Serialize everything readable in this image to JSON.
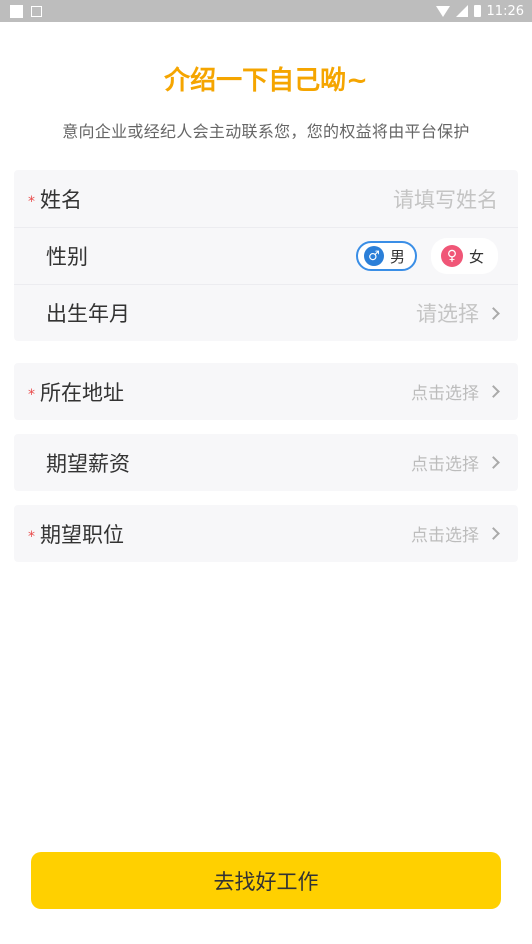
{
  "status_bar": {
    "time": "11:26"
  },
  "header": {
    "title": "介绍一下自己呦~",
    "subtitle": "意向企业或经纪人会主动联系您，您的权益将由平台保护"
  },
  "form": {
    "required_mark": "*",
    "name": {
      "label": "姓名",
      "placeholder": "请填写姓名"
    },
    "gender": {
      "label": "性别",
      "male": "男",
      "female": "女",
      "selected": "男"
    },
    "birth": {
      "label": "出生年月",
      "hint": "请选择"
    },
    "address": {
      "label": "所在地址",
      "hint": "点击选择"
    },
    "salary": {
      "label": "期望薪资",
      "hint": "点击选择"
    },
    "position": {
      "label": "期望职位",
      "hint": "点击选择"
    }
  },
  "submit_label": "去找好工作",
  "colors": {
    "accent": "#f5a500",
    "button": "#ffd000",
    "male": "#2b7fd8",
    "female": "#f05677",
    "required": "#e94b4b"
  }
}
